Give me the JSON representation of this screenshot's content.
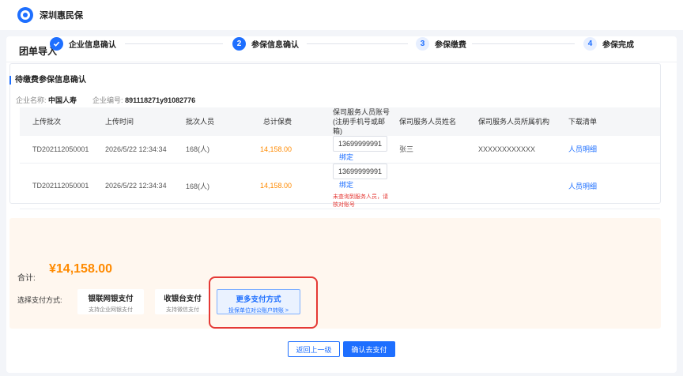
{
  "app": {
    "brand": "深圳惠民保"
  },
  "page": {
    "title": "团单导入"
  },
  "steps": [
    {
      "number": "1",
      "label": "企业信息确认",
      "state": "done"
    },
    {
      "number": "2",
      "label": "参保信息确认",
      "state": "active"
    },
    {
      "number": "3",
      "label": "参保缴费",
      "state": "todo"
    },
    {
      "number": "4",
      "label": "参保完成",
      "state": "todo"
    }
  ],
  "section": {
    "title": "待缴费参保信息确认"
  },
  "company": {
    "name_label": "企业名称:",
    "name": "中国人寿",
    "code_label": "企业编号:",
    "code": "891118271y91082776"
  },
  "table": {
    "headers": [
      "上传批次",
      "上传时间",
      "批次人员",
      "总计保费",
      "保司服务人员账号",
      "(注册手机号或邮箱)",
      "保司服务人员姓名",
      "保司服务人员所属机构",
      "下载清单"
    ],
    "rows": [
      {
        "batch": "TD202112050001",
        "time": "2026/5/22 12:34:34",
        "people": "168(人)",
        "premium": "14,158.00",
        "account": "13699999991",
        "bind": "绑定",
        "name": "张三",
        "org": "XXXXXXXXXXXX",
        "download": "人员明细",
        "warn": ""
      },
      {
        "batch": "TD202112050001",
        "time": "2026/5/22 12:34:34",
        "people": "168(人)",
        "premium": "14,158.00",
        "account": "13699999991",
        "bind": "绑定",
        "name": "",
        "org": "",
        "download": "人员明细",
        "warn": "未查询到服务人员，请核对账号"
      }
    ]
  },
  "payment": {
    "total_label": "合计:",
    "total_amount": "¥14,158.00",
    "method_label": "选择支付方式:",
    "options": [
      {
        "title": "银联网银支付",
        "subtitle": "支持企业网银支付"
      },
      {
        "title": "收银台支付",
        "subtitle": "支持微信支付"
      },
      {
        "title": "更多支付方式",
        "subtitle": "投保单位对公账户转账 >"
      }
    ]
  },
  "buttons": {
    "back": "返回上一级",
    "confirm": "确认去支付"
  },
  "colors": {
    "accent": "#1e6fff",
    "amount": "#ff8a00",
    "warning": "#e53935"
  }
}
